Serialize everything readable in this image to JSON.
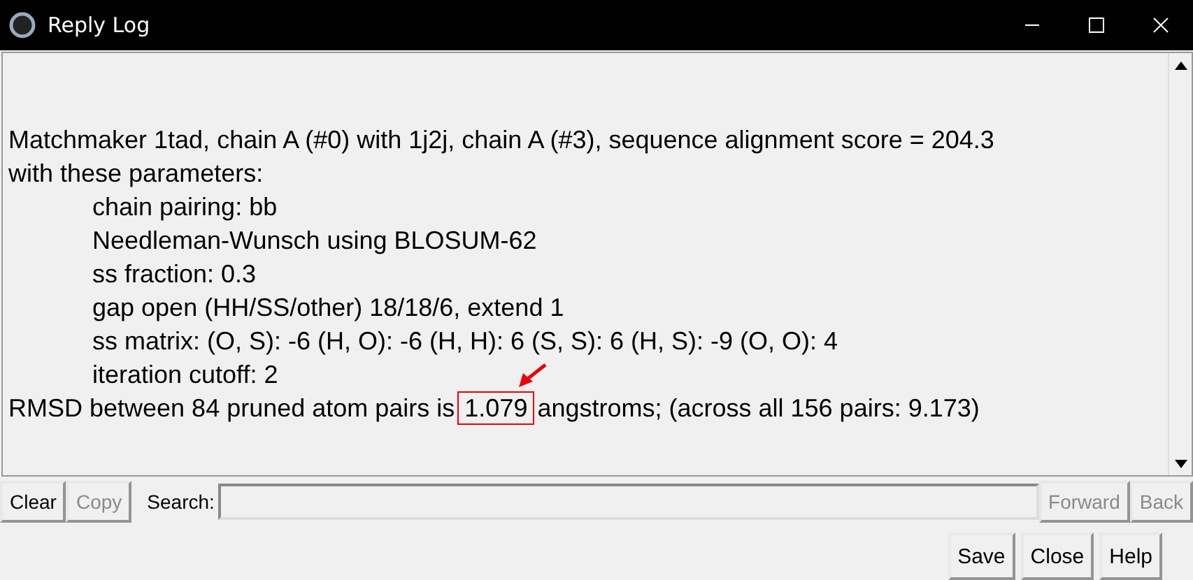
{
  "window": {
    "title": "Reply Log"
  },
  "log": {
    "heading": "Matchmaker 1tad, chain A (#0) with 1j2j, chain A (#3), sequence alignment score = 204.3",
    "intro": "with these parameters:",
    "parameters": [
      "chain pairing: bb",
      "Needleman-Wunsch using BLOSUM-62",
      "ss fraction: 0.3",
      "gap open (HH/SS/other) 18/18/6, extend 1",
      "ss matrix:  (O, S): -6 (H, O): -6 (H, H): 6 (S, S): 6 (H, S): -9 (O, O): 4",
      "iteration cutoff: 2"
    ],
    "rmsd": {
      "before": "RMSD between 84 pruned atom pairs is",
      "value": "1.079",
      "after": "angstroms; (across all 156 pairs: 9.173)",
      "highlighted": true
    }
  },
  "search_bar": {
    "left_buttons": [
      {
        "label": "Clear",
        "disabled": false
      },
      {
        "label": "Copy",
        "disabled": true
      }
    ],
    "label": "Search:",
    "right_buttons": [
      {
        "label": "Forward",
        "disabled": true
      },
      {
        "label": "Back",
        "disabled": true
      }
    ]
  },
  "buttons": [
    "Save",
    "Close",
    "Help"
  ]
}
